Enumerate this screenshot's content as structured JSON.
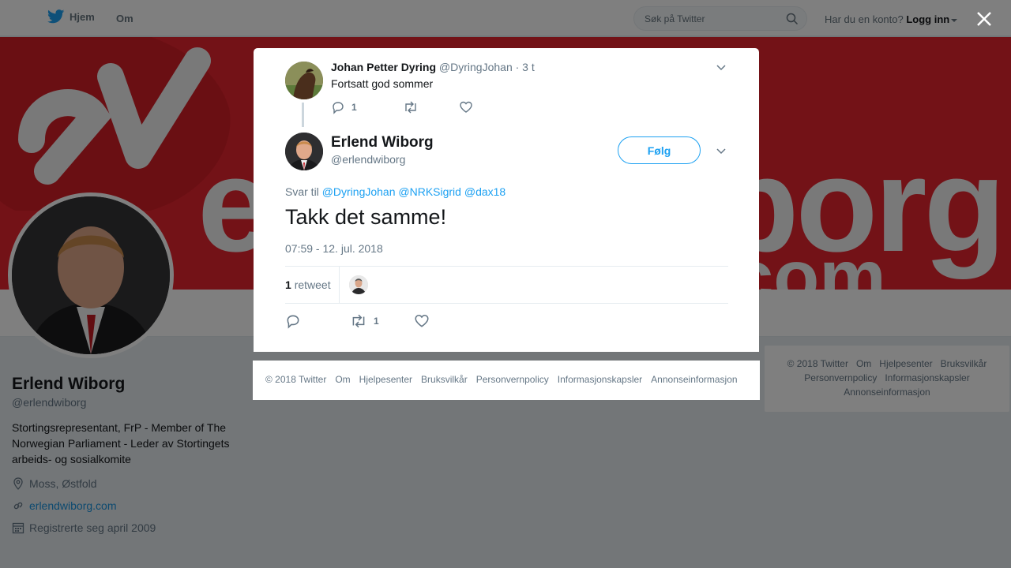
{
  "nav": {
    "home_label": "Hjem",
    "about_label": "Om",
    "search_placeholder": "Søk på Twitter",
    "account_prompt": "Har du en konto?",
    "login_label": "Logg inn"
  },
  "profile": {
    "name": "Erlend Wiborg",
    "handle": "@erlendwiborg",
    "bio": "Stortingsrepresentant, FrP - Member of The Norwegian Parliament - Leder av Stortingets arbeids- og sosialkomite",
    "location": "Moss, Østfold",
    "website": "erlendwiborg.com",
    "joined": "Registrerte seg april 2009"
  },
  "banner": {
    "text_main": "erlendwiborg",
    "text_sub": ".com"
  },
  "parent_tweet": {
    "author_name": "Johan Petter Dyring",
    "author_handle": "@DyringJohan",
    "time": "· 3 t",
    "text": "Fortsatt god sommer",
    "reply_count": "1"
  },
  "tweet": {
    "author_name": "Erlend Wiborg",
    "author_handle": "@erlendwiborg",
    "follow_label": "Følg",
    "reply_to_prefix": "Svar til",
    "reply_to_mentions": [
      "@DyringJohan",
      "@NRKSigrid",
      "@dax18"
    ],
    "text": "Takk det samme!",
    "timestamp": "07:59 - 12. jul. 2018",
    "retweet_count": "1",
    "retweet_label": "retweet",
    "action_retweet_count": "1"
  },
  "footer": {
    "links": [
      "© 2018 Twitter",
      "Om",
      "Hjelpesenter",
      "Bruksvilkår",
      "Personvernpolicy",
      "Informasjonskapsler",
      "Annonseinformasjon"
    ]
  },
  "colors": {
    "brand": "#1da1f2",
    "banner": "#e6242e"
  }
}
